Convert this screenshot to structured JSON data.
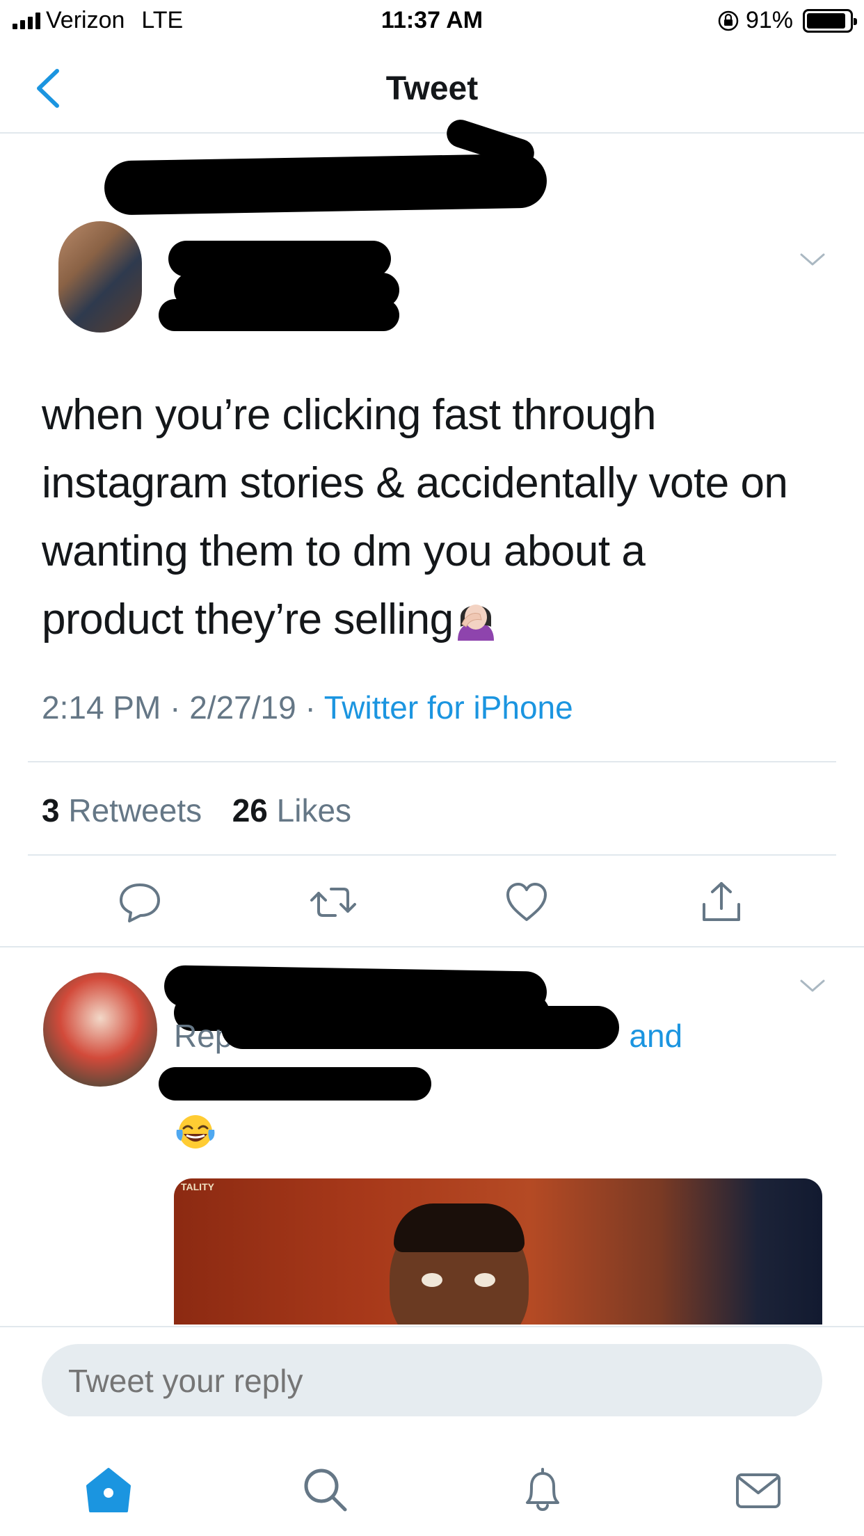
{
  "status_bar": {
    "carrier": "Verizon",
    "network": "LTE",
    "time": "11:37 AM",
    "battery_percent": "91%",
    "battery_level": 0.91,
    "icons": [
      "signal-icon",
      "orientation-lock-icon",
      "battery-icon"
    ]
  },
  "nav": {
    "title": "Tweet",
    "back_icon": "chevron-left-icon"
  },
  "tweet": {
    "text_lines": [
      "when you’re clicking fast through",
      "instagram stories & accidentally vote on",
      "wanting them to dm you about a",
      "product they’re selling"
    ],
    "emoji": "facepalm-woman-emoji",
    "time": "2:14 PM",
    "date": "2/27/19",
    "separator": "·",
    "source": "Twitter for iPhone",
    "retweets_count": "3",
    "retweets_label": "Retweets",
    "likes_count": "26",
    "likes_label": "Likes"
  },
  "actions": [
    "reply-icon",
    "retweet-icon",
    "like-icon",
    "share-icon"
  ],
  "reply": {
    "replying_prefix": "Rep",
    "replying_link": "and",
    "emoji": "face-with-tears-of-joy-emoji",
    "media_label": "TALITY"
  },
  "compose": {
    "placeholder": "Tweet your reply"
  },
  "tabs": [
    "home-icon",
    "search-icon",
    "notifications-icon",
    "messages-icon"
  ],
  "colors": {
    "accent": "#1b95e0",
    "text_primary": "#14171a",
    "text_secondary": "#657786",
    "divider": "#e1e8ed",
    "input_bg": "#e6ecf0"
  }
}
